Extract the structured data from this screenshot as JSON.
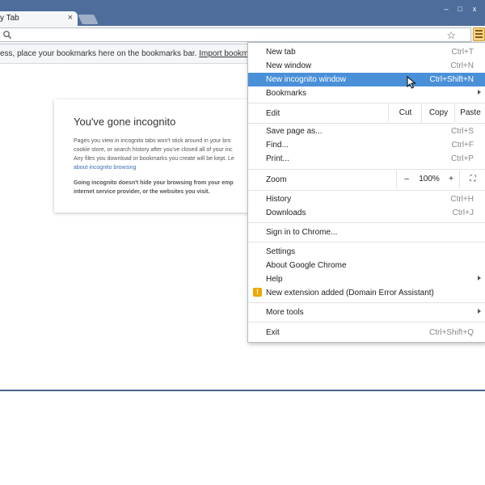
{
  "tab": {
    "title": "y Tab",
    "close": "×"
  },
  "window_controls": {
    "minimize": "–",
    "maximize": "□",
    "close": "x"
  },
  "bookmarks_bar": {
    "text": "ess, place your bookmarks here on the bookmarks bar.",
    "link": "Import bookmark"
  },
  "page": {
    "title": "You've gone incognito",
    "paragraph1_lines": [
      "Pages you view in incognito tabs won't stick around in your bro",
      "cookie store, or search history after you've closed all of your inc",
      "Any files you download or bookmarks you create will be kept. Le"
    ],
    "link_text": "about incognito browsing",
    "paragraph2_lines": [
      "Going incognito doesn't hide your browsing from your emp",
      "internet service provider, or the websites you visit."
    ]
  },
  "menu": {
    "new_tab": {
      "label": "New tab",
      "shortcut": "Ctrl+T"
    },
    "new_window": {
      "label": "New window",
      "shortcut": "Ctrl+N"
    },
    "new_incognito": {
      "label": "New incognito window",
      "shortcut": "Ctrl+Shift+N"
    },
    "bookmarks": {
      "label": "Bookmarks"
    },
    "edit": {
      "label": "Edit",
      "cut": "Cut",
      "copy": "Copy",
      "paste": "Paste"
    },
    "save_page": {
      "label": "Save page as...",
      "shortcut": "Ctrl+S"
    },
    "find": {
      "label": "Find...",
      "shortcut": "Ctrl+F"
    },
    "print": {
      "label": "Print...",
      "shortcut": "Ctrl+P"
    },
    "zoom": {
      "label": "Zoom",
      "minus": "–",
      "level": "100%",
      "plus": "+",
      "fullscreen": "⛶"
    },
    "history": {
      "label": "History",
      "shortcut": "Ctrl+H"
    },
    "downloads": {
      "label": "Downloads",
      "shortcut": "Ctrl+J"
    },
    "sign_in": {
      "label": "Sign in to Chrome..."
    },
    "settings": {
      "label": "Settings"
    },
    "about": {
      "label": "About Google Chrome"
    },
    "help": {
      "label": "Help"
    },
    "extension": {
      "label": "New extension added (Domain Error Assistant)",
      "icon": "!"
    },
    "more_tools": {
      "label": "More tools"
    },
    "exit": {
      "label": "Exit",
      "shortcut": "Ctrl+Shift+Q"
    }
  },
  "colors": {
    "titlebar": "#4f6d9a",
    "highlight": "#4a90d9",
    "warning": "#f0a500"
  }
}
